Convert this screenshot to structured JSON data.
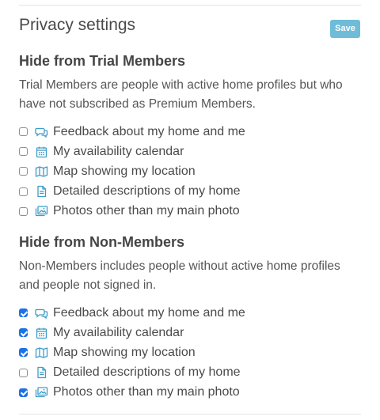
{
  "title": "Privacy settings",
  "save_label": "Save",
  "sections": [
    {
      "heading": "Hide from Trial Members",
      "description_line1": "Trial Members are people with active home profiles but who",
      "description_line2": "have not subscribed as Premium Members.",
      "options": [
        {
          "label": "Feedback about my home and me",
          "icon": "feedback-icon",
          "checked": false
        },
        {
          "label": "My availability calendar",
          "icon": "calendar-icon",
          "checked": false
        },
        {
          "label": "Map showing my location",
          "icon": "map-icon",
          "checked": false
        },
        {
          "label": "Detailed descriptions of my home",
          "icon": "document-icon",
          "checked": false
        },
        {
          "label": "Photos other than my main photo",
          "icon": "photos-icon",
          "checked": false
        }
      ]
    },
    {
      "heading": "Hide from Non-Members",
      "description_line1": "Non-Members includes people without active home profiles",
      "description_line2": "and people not signed in.",
      "options": [
        {
          "label": "Feedback about my home and me",
          "icon": "feedback-icon",
          "checked": true
        },
        {
          "label": "My availability calendar",
          "icon": "calendar-icon",
          "checked": true
        },
        {
          "label": "Map showing my location",
          "icon": "map-icon",
          "checked": true
        },
        {
          "label": "Detailed descriptions of my home",
          "icon": "document-icon",
          "checked": false
        },
        {
          "label": "Photos other than my main photo",
          "icon": "photos-icon",
          "checked": true
        }
      ]
    }
  ],
  "colors": {
    "accent": "#6fbcd9",
    "icon": "#3f9cc9",
    "checkbox_checked": "#1a73e8"
  }
}
